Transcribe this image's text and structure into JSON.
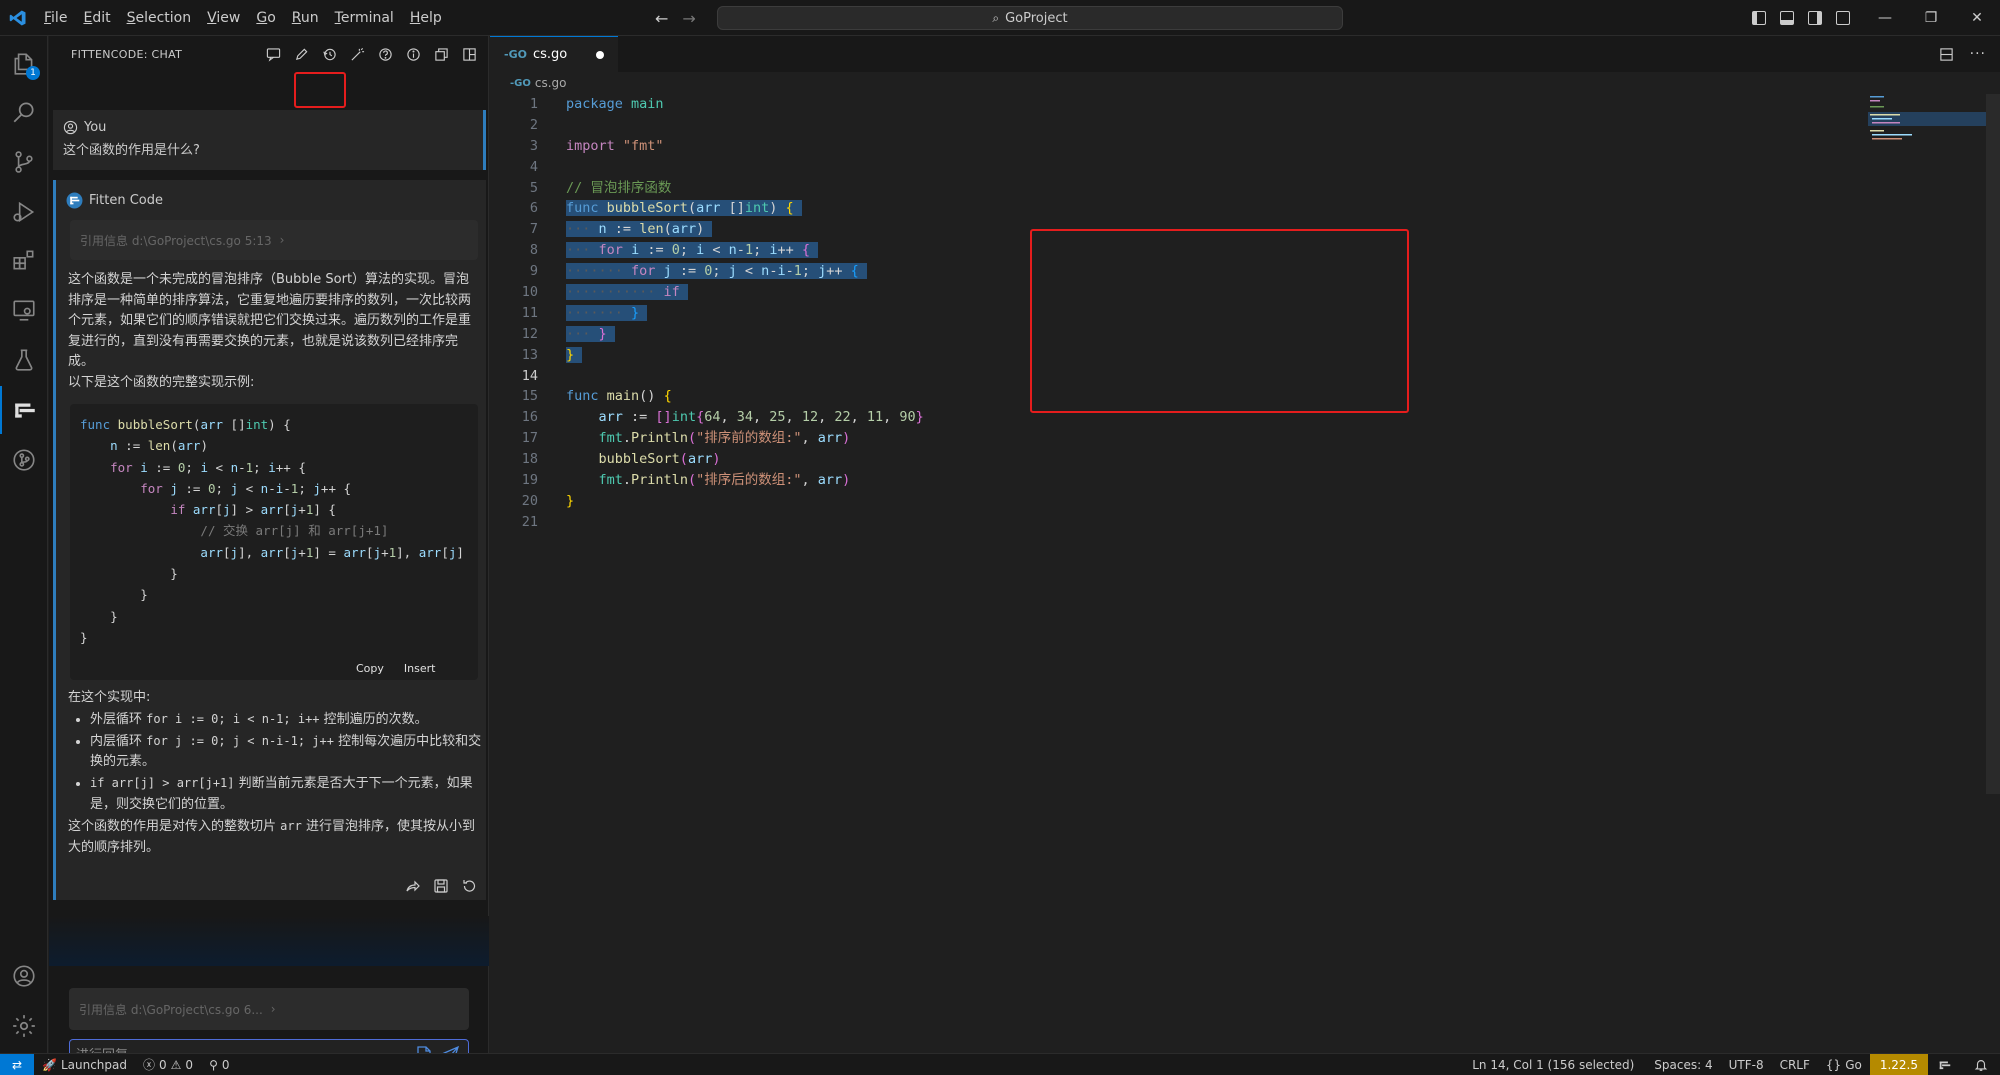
{
  "titlebar": {
    "menu": [
      {
        "label": "File",
        "mnemonic": "F",
        "rest": "ile"
      },
      {
        "label": "Edit",
        "mnemonic": "E",
        "rest": "dit"
      },
      {
        "label": "Selection",
        "mnemonic": "S",
        "rest": "election"
      },
      {
        "label": "View",
        "mnemonic": "V",
        "rest": "iew"
      },
      {
        "label": "Go",
        "mnemonic": "G",
        "rest": "o"
      },
      {
        "label": "Run",
        "mnemonic": "R",
        "rest": "un"
      },
      {
        "label": "Terminal",
        "mnemonic": "T",
        "rest": "erminal"
      },
      {
        "label": "Help",
        "mnemonic": "H",
        "rest": "elp"
      }
    ],
    "search_text": "GoProject"
  },
  "sidepanel": {
    "title": "FITTENCODE: CHAT",
    "user": {
      "name": "You",
      "question": "这个函数的作用是什么?"
    },
    "assistant": {
      "name": "Fitten Code",
      "reference": "引用信息 d:\\GoProject\\cs.go 5:13",
      "intro": "这个函数是一个未完成的冒泡排序（Bubble Sort）算法的实现。冒泡排序是一种简单的排序算法，它重复地遍历要排序的数列，一次比较两个元素，如果它们的顺序错误就把它们交换过来。遍历数列的工作是重复进行的，直到没有再需要交换的元素，也就是说该数列已经排序完成。",
      "intro2": "以下是这个函数的完整实现示例:",
      "copy_label": "Copy",
      "insert_label": "Insert",
      "explain_title": "在这个实现中:",
      "bullets": [
        {
          "pre": "外层循环 ",
          "code": "for i := 0; i < n-1; i++",
          "post": " 控制遍历的次数。"
        },
        {
          "pre": "内层循环 ",
          "code": "for j := 0; j < n-i-1; j++",
          "post": " 控制每次遍历中比较和交换的元素。"
        },
        {
          "pre": "",
          "code": "if arr[j] > arr[j+1]",
          "post": " 判断当前元素是否大于下一个元素，如果是，则交换它们的位置。"
        }
      ],
      "summary_pre": "这个函数的作用是对传入的整数切片 ",
      "summary_code": "arr",
      "summary_post": " 进行冒泡排序，使其按从小到大的顺序排列。"
    },
    "input_reference": "引用信息 d:\\GoProject\\cs.go 6...",
    "input_placeholder": "进行回复..."
  },
  "editor": {
    "tab_label": "cs.go",
    "breadcrumb": "cs.go",
    "line_numbers": [
      "1",
      "2",
      "3",
      "4",
      "5",
      "6",
      "7",
      "8",
      "9",
      "10",
      "11",
      "12",
      "13",
      "14",
      "15",
      "16",
      "17",
      "18",
      "19",
      "20",
      "21"
    ]
  },
  "statusbar": {
    "launchpad": "Launchpad",
    "errors": "0",
    "warnings": "0",
    "ports": "0",
    "position": "Ln 14, Col 1 (156 selected)",
    "spaces": "Spaces: 4",
    "encoding": "UTF-8",
    "eol": "CRLF",
    "language": "Go",
    "go_version": "1.22.5"
  },
  "colors": {
    "accent": "#0078d4",
    "highlight_box": "#e51d1d",
    "selection": "#264f78",
    "go_version_bg": "#b58a00"
  }
}
